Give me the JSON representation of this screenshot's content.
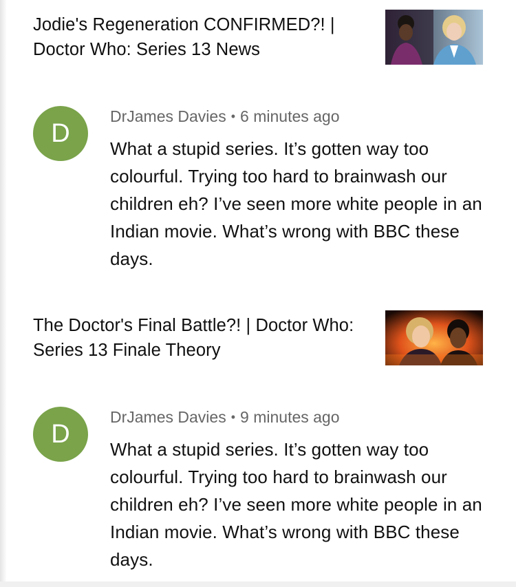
{
  "feed": {
    "items": [
      {
        "video": {
          "title": "Jodie's Regeneration CONFIRMED?! | Doctor Who: Series 13 News"
        },
        "comment": {
          "avatar_initial": "D",
          "avatar_color": "#7aa34a",
          "author": "DrJames Davies",
          "separator": "•",
          "timestamp": "6 minutes ago",
          "text": "What a stupid series. It’s gotten way too colourful. Trying too hard to brainwash our children eh? I’ve seen more white people in an Indian movie. What’s wrong with BBC these days."
        }
      },
      {
        "video": {
          "title": "The Doctor's Final Battle?! | Doctor Who: Series 13 Finale Theory"
        },
        "comment": {
          "avatar_initial": "D",
          "avatar_color": "#7aa34a",
          "author": "DrJames Davies",
          "separator": "•",
          "timestamp": "9 minutes ago",
          "text": "What a stupid series. It’s gotten way too colourful. Trying too hard to brainwash our children eh? I’ve seen more white people in an Indian movie. What’s wrong with BBC these days."
        }
      }
    ]
  }
}
